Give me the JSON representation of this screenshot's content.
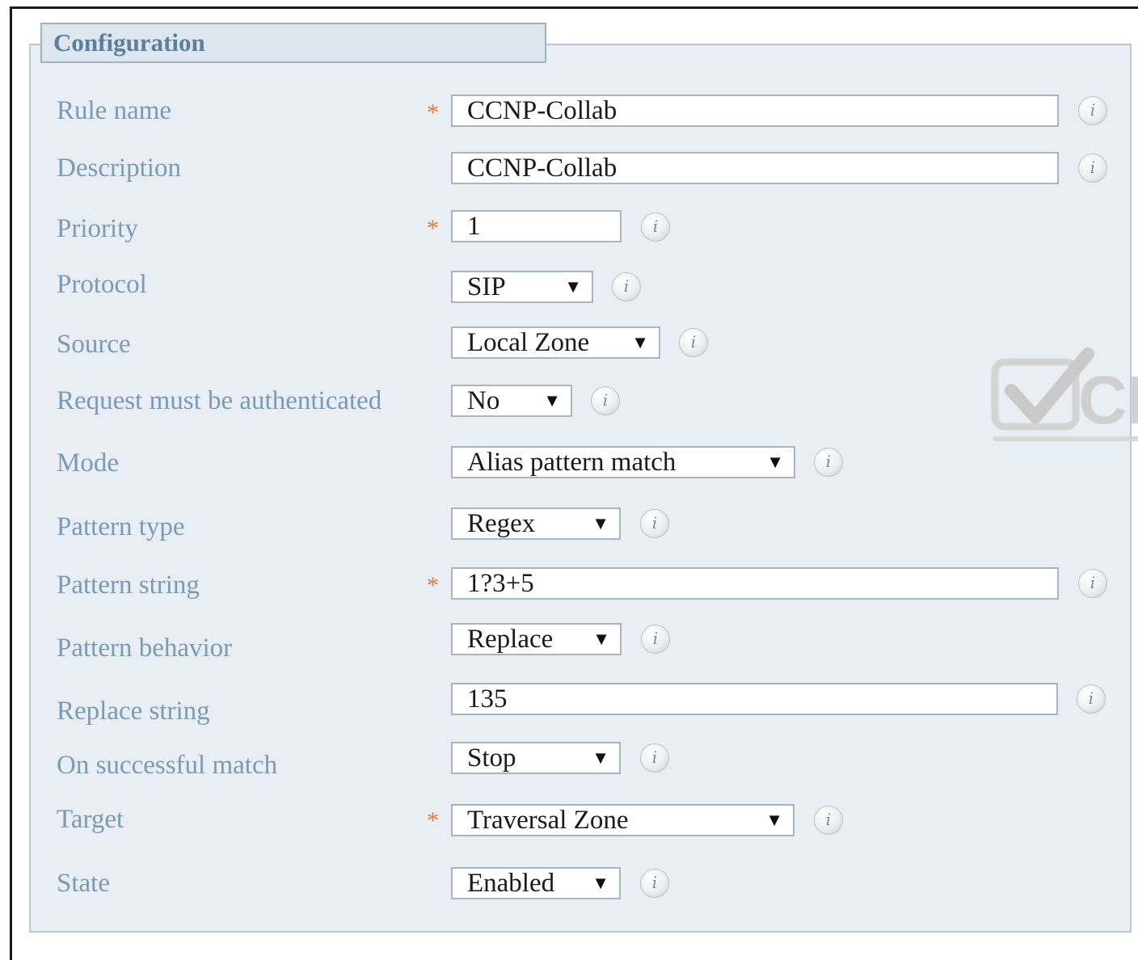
{
  "section_title": "Configuration",
  "rows": [
    {
      "label": "Rule name",
      "required": true,
      "type": "text",
      "value": "CCNP-Collab"
    },
    {
      "label": "Description",
      "required": false,
      "type": "text",
      "value": "CCNP-Collab"
    },
    {
      "label": "Priority",
      "required": true,
      "type": "text",
      "value": "1"
    },
    {
      "label": "Protocol",
      "required": false,
      "type": "select",
      "value": "SIP"
    },
    {
      "label": "Source",
      "required": false,
      "type": "select",
      "value": "Local Zone"
    },
    {
      "label": "Request must be authenticated",
      "required": false,
      "type": "select",
      "value": "No"
    },
    {
      "label": "Mode",
      "required": false,
      "type": "select",
      "value": "Alias pattern match"
    },
    {
      "label": "Pattern type",
      "required": false,
      "type": "select",
      "value": "Regex"
    },
    {
      "label": "Pattern string",
      "required": true,
      "type": "text",
      "value": "1?3+5"
    },
    {
      "label": "Pattern behavior",
      "required": false,
      "type": "select",
      "value": "Replace"
    },
    {
      "label": "Replace string",
      "required": false,
      "type": "text",
      "value": "135"
    },
    {
      "label": "On successful match",
      "required": false,
      "type": "select",
      "value": "Stop"
    },
    {
      "label": "Target",
      "required": true,
      "type": "select",
      "value": "Traversal Zone"
    },
    {
      "label": "State",
      "required": false,
      "type": "select",
      "value": "Enabled"
    }
  ],
  "required_marker": "*",
  "info_glyph": "i",
  "dropdown_glyph": "▼",
  "colors": {
    "panel_bg": "#e8eef3",
    "label": "#7a9ab5",
    "required": "#e07a35",
    "title": "#5c7fa0"
  },
  "watermark_text": "CE"
}
